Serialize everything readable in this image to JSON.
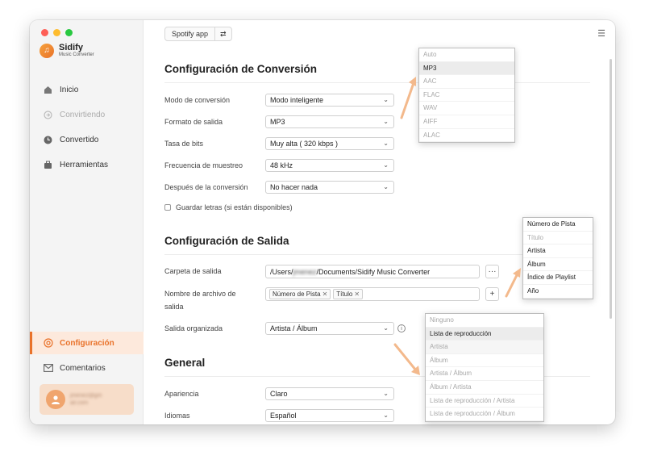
{
  "sidebar": {
    "app_name": "Sidify",
    "app_sub": "Music Converter",
    "items": [
      {
        "label": "Inicio",
        "icon": "home-icon"
      },
      {
        "label": "Convirtiendo",
        "icon": "converting-icon"
      },
      {
        "label": "Convertido",
        "icon": "clock-icon"
      },
      {
        "label": "Herramientas",
        "icon": "toolbox-icon"
      }
    ],
    "bottom_items": [
      {
        "label": "Configuración",
        "icon": "gear-icon"
      },
      {
        "label": "Comentarios",
        "icon": "mail-icon"
      }
    ],
    "user_email_line1": "jmenez@gm",
    "user_email_line2": "ail.com"
  },
  "header": {
    "source_label": "Spotify app"
  },
  "conversion": {
    "title": "Configuración de Conversión",
    "rows": [
      {
        "label": "Modo de conversión",
        "value": "Modo inteligente"
      },
      {
        "label": "Formato de salida",
        "value": "MP3"
      },
      {
        "label": "Tasa de bits",
        "value": "Muy alta ( 320 kbps )"
      },
      {
        "label": "Frecuencia de muestreo",
        "value": "48 kHz"
      },
      {
        "label": "Después de la conversión",
        "value": "No hacer nada"
      }
    ],
    "lyrics_checkbox": "Guardar letras (si están disponibles)"
  },
  "output": {
    "title": "Configuración de Salida",
    "folder_label": "Carpeta de salida",
    "folder_prefix": "/Users/",
    "folder_user": "jmenez",
    "folder_suffix": "/Documents/Sidify Music Converter",
    "folder_button": "···",
    "filename_label_1": "Nombre de archivo de",
    "filename_label_2": "salida",
    "filename_tags": [
      "Número de Pista",
      "Título"
    ],
    "add_button": "+",
    "organized_label": "Salida organizada",
    "organized_value": "Artista  /  Álbum"
  },
  "general": {
    "title": "General",
    "rows": [
      {
        "label": "Apariencia",
        "value": "Claro"
      },
      {
        "label": "Idiomas",
        "value": "Español"
      }
    ]
  },
  "format_dropdown": [
    "Auto",
    "MP3",
    "AAC",
    "FLAC",
    "WAV",
    "AIFF",
    "ALAC"
  ],
  "tag_dropdown": [
    "Número de Pista",
    "Título",
    "Artista",
    "Álbum",
    "Índice de Playlist",
    "Año"
  ],
  "organized_dropdown": [
    "Ninguno",
    "Lista de reproducción",
    "Artista",
    "Álbum",
    "Artista / Álbum",
    "Álbum / Artista",
    "Lista de reproducción / Artista",
    "Lista de reproducción / Álbum"
  ],
  "colors": {
    "accent": "#e9722a",
    "arrow": "#f3b98c"
  }
}
